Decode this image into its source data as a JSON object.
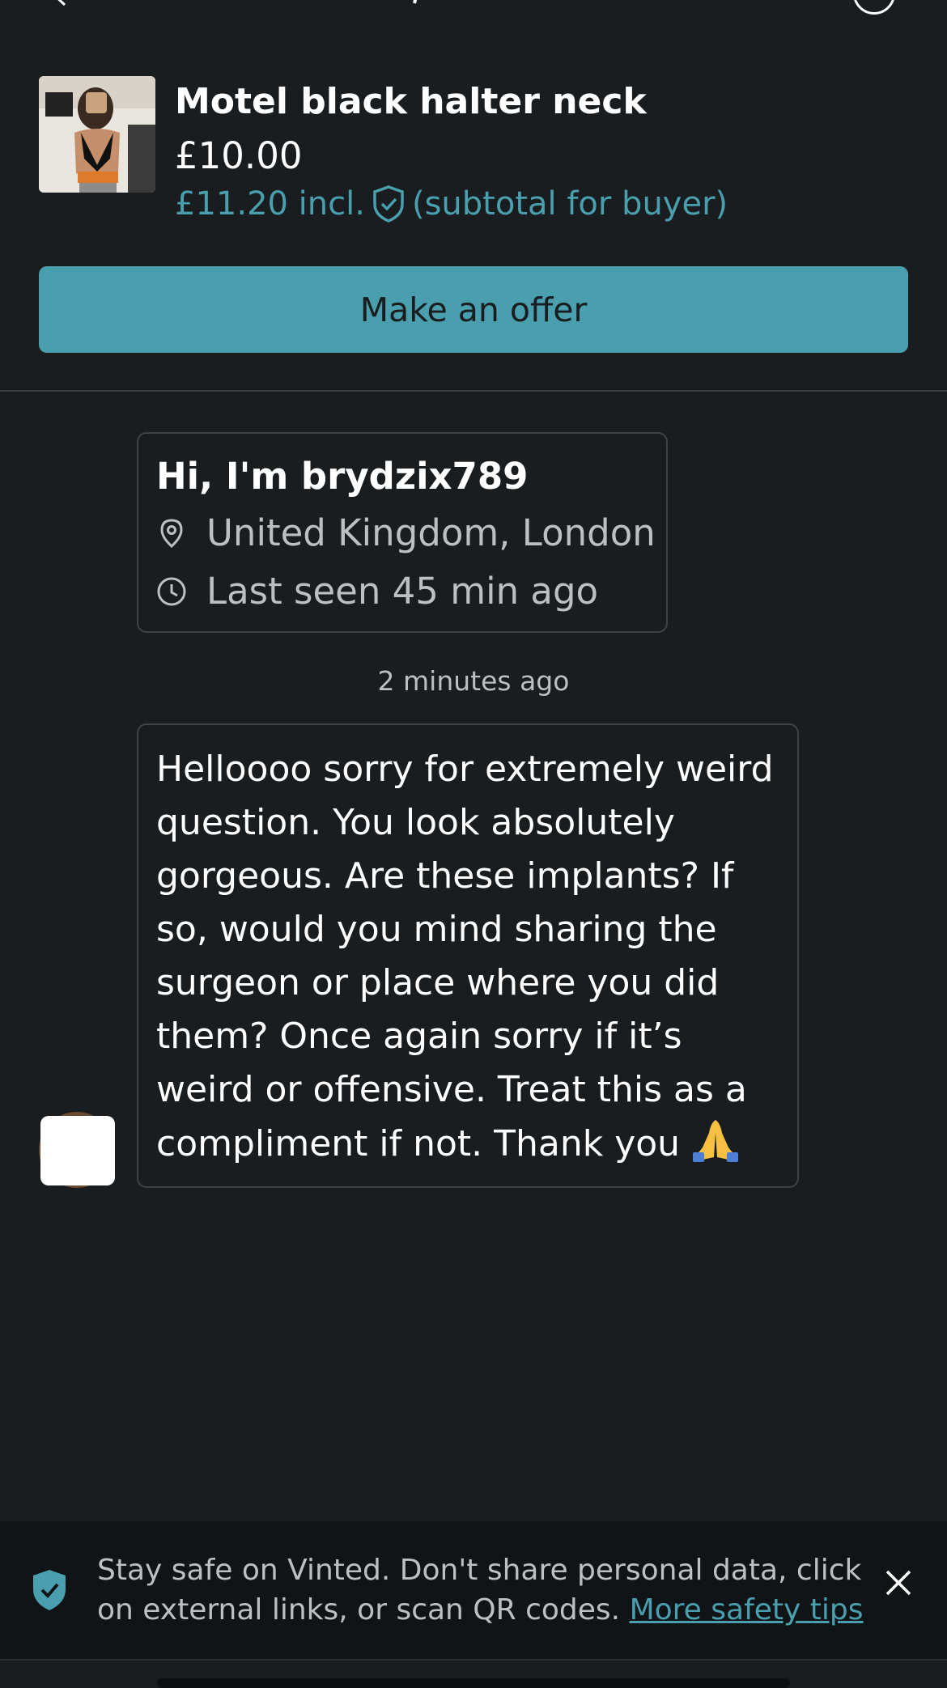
{
  "item": {
    "title": "Motel black halter neck",
    "price": "£10.00",
    "price_incl": "£11.20 incl.",
    "price_incl_note": "(subtotal for buyer)"
  },
  "actions": {
    "offer_label": "Make an offer"
  },
  "profile": {
    "greeting": "Hi, I'm brydzix789",
    "location": "United Kingdom, London",
    "last_seen": "Last seen 45 min ago"
  },
  "conversation": {
    "timestamp": "2 minutes ago",
    "message": "Helloooo sorry for extremely weird\nquestion. You look absolutely\ngorgeous. Are these implants? If\nso, would you mind sharing the\nsurgeon or place where you did\nthem? Once again sorry if it’s\nweird or offensive. Treat this as a\ncompliment if not. Thank you "
  },
  "safety": {
    "text": "Stay safe on Vinted. Don't share personal data, click on external links, or scan QR codes. ",
    "link": "More safety tips"
  },
  "colors": {
    "background": "#1a1d1f",
    "accent": "#4a9fae",
    "banner": "#111416"
  },
  "icons": [
    "back-arrow-icon",
    "info-icon",
    "buyer-protection-shield-icon",
    "location-pin-icon",
    "clock-icon",
    "praying-hands-emoji",
    "safety-shield-icon",
    "close-icon"
  ]
}
